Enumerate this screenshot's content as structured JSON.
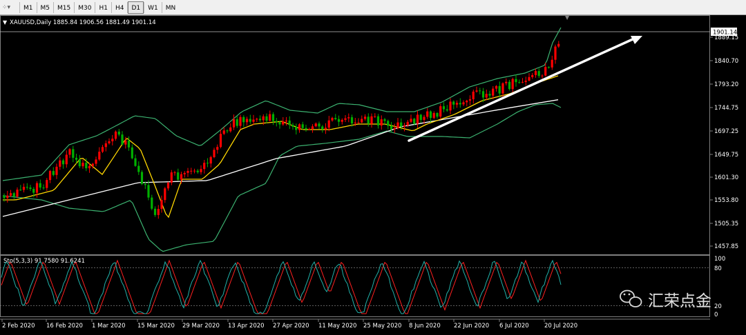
{
  "toolbar": {
    "timeframes": [
      {
        "label": "M1",
        "active": false
      },
      {
        "label": "M5",
        "active": false
      },
      {
        "label": "M15",
        "active": false
      },
      {
        "label": "M30",
        "active": false
      },
      {
        "label": "H1",
        "active": false
      },
      {
        "label": "H4",
        "active": false
      },
      {
        "label": "D1",
        "active": true
      },
      {
        "label": "W1",
        "active": false
      },
      {
        "label": "MN",
        "active": false
      }
    ]
  },
  "chart": {
    "symbol_header": "XAUUSD,Daily  1885.84 1906.56 1881.49 1901.14",
    "current_price": "1901.14",
    "price_ticks": [
      "1889.15",
      "1840.70",
      "1793.20",
      "1744.75",
      "1697.25",
      "1649.75",
      "1601.30",
      "1553.80",
      "1505.35",
      "1457.85"
    ],
    "colors": {
      "bull": "#ff0000",
      "bear": "#00b000",
      "bands": "#3cb371",
      "ma_yellow": "#ffd700",
      "ma_white": "#ffffff"
    }
  },
  "oscillator": {
    "header": "Sto(5,3,3) 91.7580 91.6241",
    "ticks": [
      "100",
      "80",
      "20",
      "0"
    ]
  },
  "date_ticks": [
    "2 Feb 2020",
    "16 Feb 2020",
    "1 Mar 2020",
    "15 Mar 2020",
    "29 Mar 2020",
    "13 Apr 2020",
    "27 Apr 2020",
    "11 May 2020",
    "25 May 2020",
    "8 Jun 2020",
    "22 Jun 2020",
    "6 Jul 2020",
    "20 Jul 2020"
  ],
  "watermark": {
    "text": "汇荣点金"
  }
}
